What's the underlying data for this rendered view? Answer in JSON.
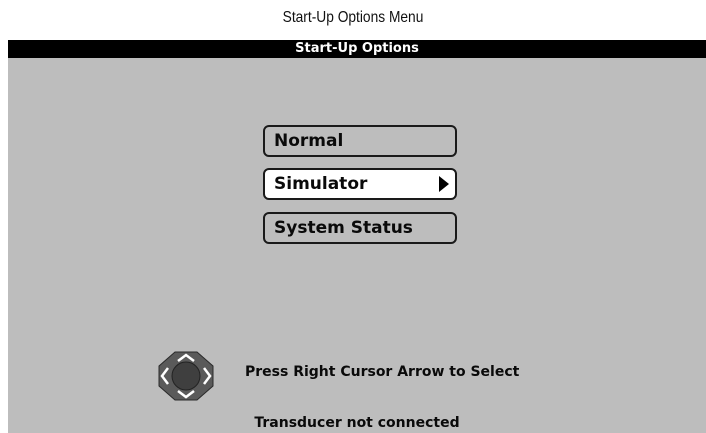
{
  "caption": "Start-Up Options Menu",
  "window": {
    "title": "Start-Up Options"
  },
  "menu": {
    "items": [
      {
        "label": "Normal",
        "selected": false
      },
      {
        "label": "Simulator",
        "selected": true
      },
      {
        "label": "System Status",
        "selected": false
      }
    ]
  },
  "hint": {
    "text": "Press Right Cursor Arrow to Select",
    "icon": "cursor-pad-icon"
  },
  "status": {
    "text": "Transducer not connected"
  },
  "colors": {
    "screen_bg": "#bdbdbd",
    "titlebar_bg": "#000000",
    "selected_bg": "#ffffff"
  }
}
